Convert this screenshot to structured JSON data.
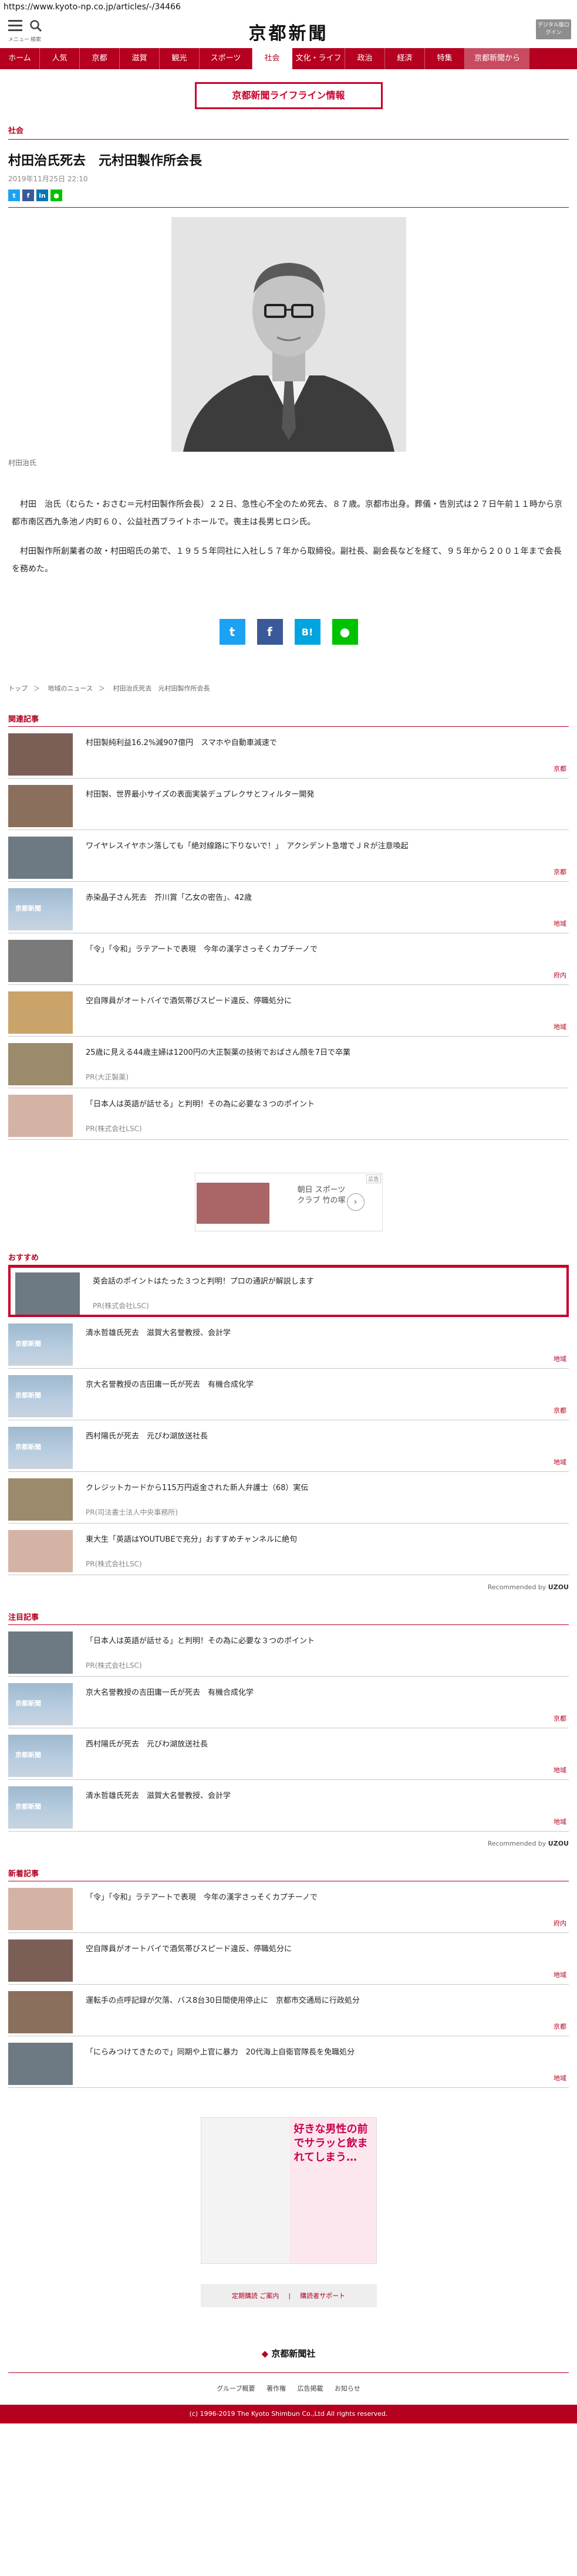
{
  "url": "https://www.kyoto-np.co.jp/articles/-/34466",
  "header": {
    "logo": "京都新聞",
    "menu_label": "メニュー",
    "search_label": "検索",
    "digital_label": "デジタル版ログイン"
  },
  "nav": [
    "ホーム",
    "人気",
    "京都",
    "滋賀",
    "観光",
    "スポーツ",
    "社会",
    "文化・ライフ",
    "政治",
    "経済",
    "特集",
    "京都新聞から"
  ],
  "lifeline": "京都新聞ライフライン情報",
  "article": {
    "category": "社会",
    "title": "村田治氏死去　元村田製作所会長",
    "date": "2019年11月25日 22:10",
    "caption": "村田治氏",
    "p1": "　村田　治氏（むらた・おさむ＝元村田製作所会長）２２日、急性心不全のため死去、８７歳。京都市出身。葬儀・告別式は２７日午前１１時から京都市南区西九条池ノ内町６０、公益社西ブライトホールで。喪主は長男ヒロシ氏。",
    "p2": "　村田製作所創業者の故・村田昭氏の弟で、１９５５年同社に入社し５７年から取締役。副社長、副会長などを経て、９５年から２００１年まで会長を務めた。"
  },
  "breadcrumb": [
    "トップ",
    "地域のニュース",
    "村田治氏死去　元村田製作所会長"
  ],
  "sections": {
    "related": "関連記事",
    "recommend": "おすすめ",
    "attention": "注目記事",
    "latest": "新着記事"
  },
  "related": [
    {
      "title": "村田製純利益16.2%減907億円　スマホや自動車減速で",
      "tag": "京都"
    },
    {
      "title": "村田製、世界最小サイズの表面実装デュプレクサとフィルター開発",
      "tag": ""
    },
    {
      "title": "ワイヤレスイヤホン落しても「絶対線路に下りないで！」　アクシデント急増でＪＲが注意喚起",
      "tag": "京都"
    },
    {
      "title": "赤染晶子さん死去　芥川賞「乙女の密告」、42歳",
      "tag": "地域"
    },
    {
      "title": "「令」「令和」ラテアートで表現　今年の漢字さっそくカプチーノで",
      "tag": "府内"
    },
    {
      "title": "空自隊員がオートバイで酒気帯びスピード違反、停職処分に",
      "tag": "地域"
    },
    {
      "title": "25歳に見える44歳主婦は1200円の大正製薬の技術でおばさん顔を7日で卒業",
      "sub": "PR(大正製薬)",
      "tag": ""
    },
    {
      "title": "「日本人は英語が話せる」と判明！その為に必要な３つのポイント",
      "sub": "PR(株式会社LSC)",
      "tag": ""
    }
  ],
  "ad_small": {
    "mark": "広告",
    "text": "朝日 スポーツ クラブ 竹の塚"
  },
  "recommend": [
    {
      "title": "英会話のポイントはたった３つと判明！プロの通訳が解説します",
      "sub": "PR(株式会社LSC)",
      "tag": ""
    },
    {
      "title": "清水哲雄氏死去　滋賀大名誉教授、会計学",
      "tag": "地域"
    },
    {
      "title": "京大名誉教授の吉田庸一氏が死去　有機合成化学",
      "tag": "京都"
    },
    {
      "title": "西村陽氏が死去　元びわ湖放送社長",
      "tag": "地域"
    },
    {
      "title": "クレジットカードから115万円返金された新人弁護士（68）実伝",
      "sub": "PR(司法書士法人中央事務所)",
      "tag": ""
    },
    {
      "title": "東大生「英語はYOUTUBEで充分」おすすめチャンネルに絶句",
      "sub": "PR(株式会社LSC)",
      "tag": ""
    }
  ],
  "recommended_by": "Recommended by",
  "recommended_brand": "UZOU",
  "attention": [
    {
      "title": "「日本人は英語が話せる」と判明！その為に必要な３つのポイント",
      "sub": "PR(株式会社LSC)",
      "tag": ""
    },
    {
      "title": "京大名誉教授の吉田庸一氏が死去　有機合成化学",
      "tag": "京都"
    },
    {
      "title": "西村陽氏が死去　元びわ湖放送社長",
      "tag": "地域"
    },
    {
      "title": "清水哲雄氏死去　滋賀大名誉教授、会計学",
      "tag": "地域"
    }
  ],
  "latest": [
    {
      "title": "「令」「令和」ラテアートで表現　今年の漢字さっそくカプチーノで",
      "tag": "府内"
    },
    {
      "title": "空自隊員がオートバイで酒気帯びスピード違反、停職処分に",
      "tag": "地域"
    },
    {
      "title": "運転手の点呼記録が欠落、バス8台30日間使用停止に　京都市交通局に行政処分",
      "tag": "京都"
    },
    {
      "title": "「にらみつけてきたので」同期や上官に暴力　20代海上自衛官隊長を免職処分",
      "tag": "地域"
    }
  ],
  "manga_ad": {
    "text": "好きな男性の前でサラッと飲まれてしまう…"
  },
  "footer": {
    "btn1": "定期購読 ご案内",
    "btn2": "購読者サポート",
    "logo": "京都新聞社",
    "links": [
      "グループ概要",
      "著作権",
      "広告掲載",
      "お知らせ"
    ],
    "copyright": "(c) 1996-2019 The Kyoto Shimbun Co.,Ltd All rights reserved."
  }
}
